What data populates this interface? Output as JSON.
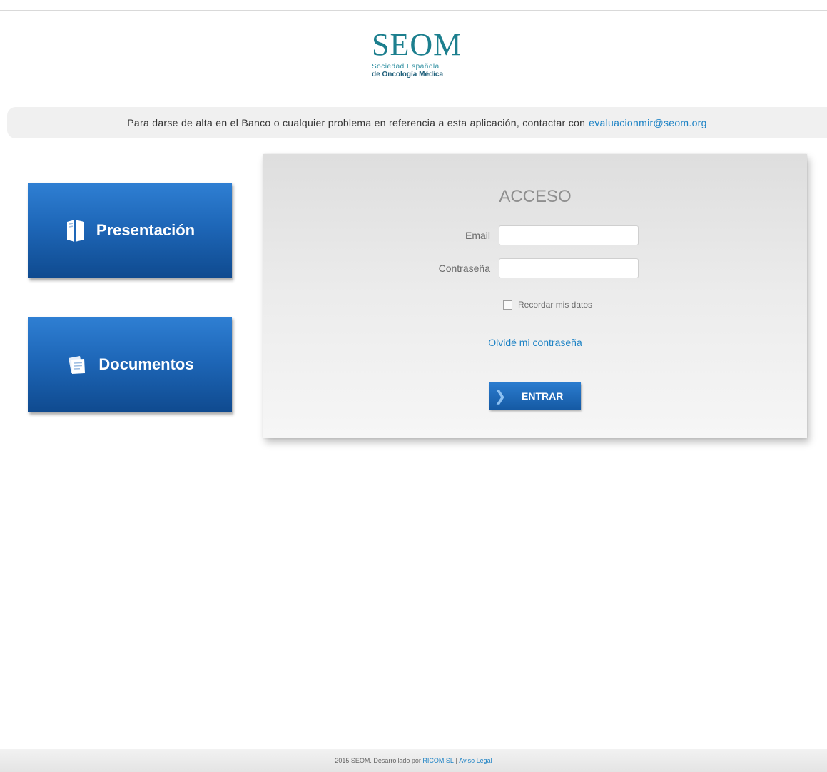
{
  "logo": {
    "main": "SEOM",
    "line1": "Sociedad Española",
    "line2": "de Oncología Médica"
  },
  "notice": {
    "text": "Para darse de alta en el Banco o cualquier problema en referencia a esta aplicación, contactar con",
    "email": "evaluacionmir@seom.org"
  },
  "sidebar": {
    "presentacion": {
      "label": "Presentación",
      "icon": "book-icon"
    },
    "documentos": {
      "label": "Documentos",
      "icon": "documents-icon"
    }
  },
  "login": {
    "title": "ACCESO",
    "email_label": "Email",
    "email_value": "",
    "password_label": "Contraseña",
    "password_value": "",
    "remember_label": "Recordar mis datos",
    "remember_checked": false,
    "forgot_label": "Olvidé mi contraseña",
    "submit_label": "ENTRAR"
  },
  "footer": {
    "prefix": "2015 SEOM. Desarrollado por",
    "company": "RICOM SL",
    "separator": "|",
    "legal": "Aviso Legal"
  },
  "colors": {
    "brand_teal": "#1c7f8e",
    "button_blue": "#1e67b8",
    "link_blue": "#1e83c5"
  }
}
